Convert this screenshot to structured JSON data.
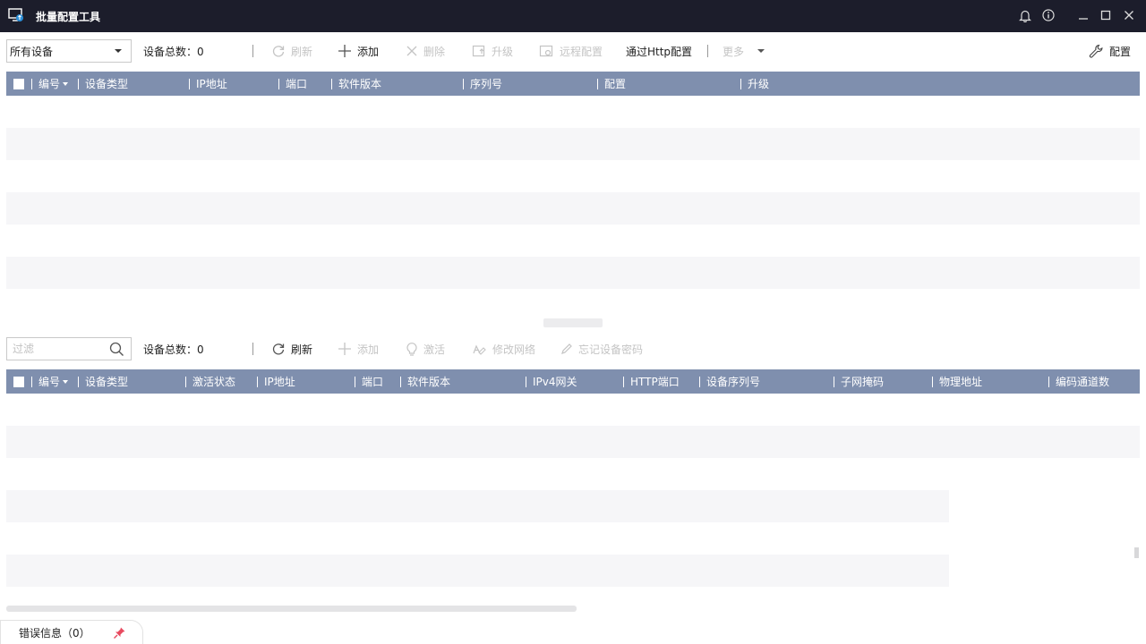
{
  "window": {
    "title": "批量配置工具"
  },
  "top_toolbar": {
    "device_filter_selected": "所有设备",
    "device_total": "设备总数：0",
    "refresh_label": "刷新",
    "add_label": "添加",
    "delete_label": "删除",
    "upgrade_label": "升级",
    "remote_config_label": "远程配置",
    "http_config_label": "通过Http配置",
    "more_label": "更多",
    "settings_label": "配置"
  },
  "top_table": {
    "columns": [
      "编号",
      "设备类型",
      "IP地址",
      "端口",
      "软件版本",
      "序列号",
      "配置",
      "升级"
    ]
  },
  "bottom_toolbar": {
    "filter_placeholder": "过滤",
    "device_total": "设备总数：0",
    "refresh_label": "刷新",
    "add_label": "添加",
    "activate_label": "激活",
    "modify_network_label": "修改网络",
    "reset_password_label": "忘记设备密码"
  },
  "bottom_table": {
    "columns": [
      "编号",
      "设备类型",
      "激活状态",
      "IP地址",
      "端口",
      "软件版本",
      "IPv4网关",
      "HTTP端口",
      "设备序列号",
      "子网掩码",
      "物理地址",
      "编码通道数"
    ]
  },
  "status_bar": {
    "error_info": "错误信息（0）"
  },
  "colors": {
    "titlebar": "#1c1d2b",
    "table_header": "#7f8fae",
    "row_alt": "#f6f6f8",
    "disabled_text": "#c4c4c4"
  }
}
